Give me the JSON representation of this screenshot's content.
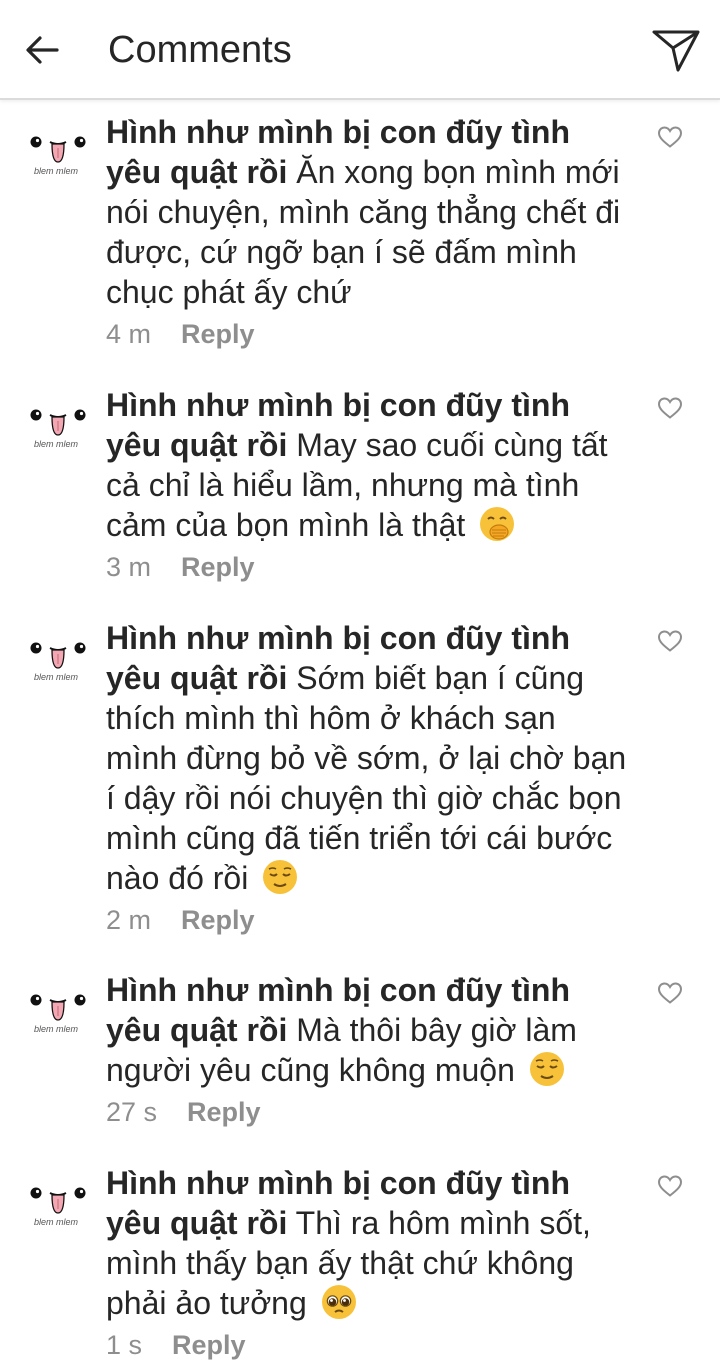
{
  "header": {
    "title": "Comments",
    "back_icon": "arrow-left-icon",
    "send_icon": "paper-plane-icon"
  },
  "colors": {
    "text": "#262626",
    "meta": "#8e8e8e",
    "divider": "#dbdbdb",
    "emoji_face": "#f7c23a"
  },
  "comments": [
    {
      "username": "Hình như mình bị con đũy tình yêu quật rồi",
      "text": "Ăn xong bọn mình mới nói chuyện, mình căng thẳng chết đi được, cứ ngỡ bạn í sẽ đấm mình chục phát ấy chứ",
      "emoji": "",
      "time": "4 m",
      "reply_label": "Reply",
      "avatar_caption": "blem mlem"
    },
    {
      "username": "Hình như mình bị con đũy tình yêu quật rồi",
      "text": "May sao cuối cùng tất cả chỉ là hiểu lầm, nhưng mà tình cảm của bọn mình là thật",
      "emoji": "hand-over-mouth-emoji",
      "time": "3 m",
      "reply_label": "Reply",
      "avatar_caption": "blem mlem"
    },
    {
      "username": "Hình như mình bị con đũy tình yêu quật rồi",
      "text": "Sớm biết bạn í cũng thích mình thì hôm ở khách sạn mình đừng bỏ về sớm, ở lại chờ bạn í dậy rồi nói chuyện thì giờ chắc bọn mình cũng đã tiến triển tới cái bước nào đó rồi",
      "emoji": "relieved-face-emoji",
      "time": "2 m",
      "reply_label": "Reply",
      "avatar_caption": "blem mlem"
    },
    {
      "username": "Hình như mình bị con đũy tình yêu quật rồi",
      "text": "Mà thôi bây giờ làm người yêu cũng không muộn",
      "emoji": "relieved-face-emoji",
      "time": "27 s",
      "reply_label": "Reply",
      "avatar_caption": "blem mlem"
    },
    {
      "username": "Hình như mình bị con đũy tình yêu quật rồi",
      "text": "Thì ra hôm mình sốt, mình thấy bạn ấy thật chứ không phải ảo tưởng",
      "emoji": "pleading-face-emoji",
      "time": "1 s",
      "reply_label": "Reply",
      "avatar_caption": "blem mlem"
    }
  ]
}
